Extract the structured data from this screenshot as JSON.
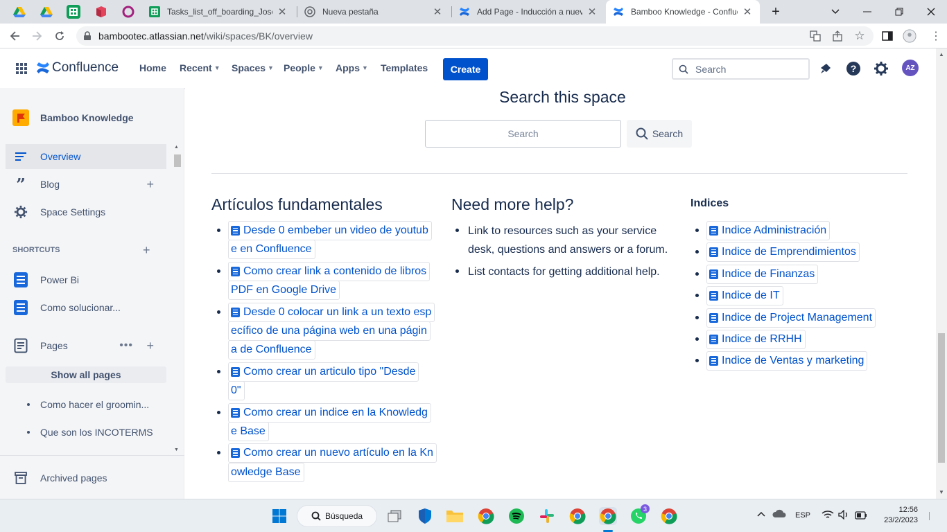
{
  "browser": {
    "tabs": [
      {
        "title": "Tasks_list_off_boarding_Jose -"
      },
      {
        "title": "Nueva pestaña"
      },
      {
        "title": "Add Page - Inducción a nuevo"
      },
      {
        "title": "Bamboo Knowledge - Conflue"
      }
    ],
    "new_tab": "+",
    "url_host": "bambootec.atlassian.net",
    "url_path": "/wiki/spaces/BK/overview"
  },
  "header": {
    "logo": "Confluence",
    "nav": [
      "Home",
      "Recent",
      "Spaces",
      "People",
      "Apps",
      "Templates"
    ],
    "create": "Create",
    "search_placeholder": "Search",
    "avatar": "AZ"
  },
  "sidebar": {
    "space_name": "Bamboo Knowledge",
    "items": [
      {
        "label": "Overview",
        "icon": "overview-icon",
        "selected": true
      },
      {
        "label": "Blog",
        "icon": "quote-icon"
      },
      {
        "label": "Space Settings",
        "icon": "gear-icon"
      }
    ],
    "shortcuts_title": "SHORTCUTS",
    "shortcuts": [
      "Power Bi",
      "Como solucionar..."
    ],
    "pages_label": "Pages",
    "show_all_pages": "Show all pages",
    "pages": [
      "Como hacer el groomin...",
      "Que son los INCOTERMS"
    ],
    "archived": "Archived pages"
  },
  "main": {
    "search_title": "Search this space",
    "search_placeholder": "Search",
    "search_button": "Search",
    "col1": {
      "title": "Artículos fundamentales",
      "links": [
        [
          "Desde 0 embeber un video de youtub",
          "e en Confluence"
        ],
        [
          "Como crear link a contenido de libros",
          "PDF en Google Drive"
        ],
        [
          "Desde 0 colocar un link a un texto esp",
          "ecífico de una página web en una págin",
          "a de Confluence"
        ],
        [
          "Como crear un articulo tipo \"Desde",
          "0\""
        ],
        [
          "Como crear un indice en la Knowledg",
          "e Base"
        ],
        [
          "Como crear un nuevo artículo en la Kn",
          "owledge Base"
        ]
      ]
    },
    "col2": {
      "title": "Need more help?",
      "items": [
        [
          "Link to resources such as your service",
          "desk, questions and answers or a forum."
        ],
        [
          "List contacts for getting additional help."
        ]
      ]
    },
    "col3": {
      "title": "Indices",
      "links": [
        "Indice Administración",
        "Indice de Emprendimientos",
        "Indice de Finanzas",
        "Indice de IT",
        "Indice de Project Management",
        "Indice de RRHH",
        "Indice de Ventas y marketing"
      ]
    }
  },
  "taskbar": {
    "search": "Búsqueda",
    "lang": "ESP",
    "time": "12:56",
    "date": "23/2/2023",
    "whatsapp_badge": "3"
  },
  "colors": {
    "brand": "#0052cc",
    "link": "#0052cc",
    "text": "#172b4d"
  }
}
